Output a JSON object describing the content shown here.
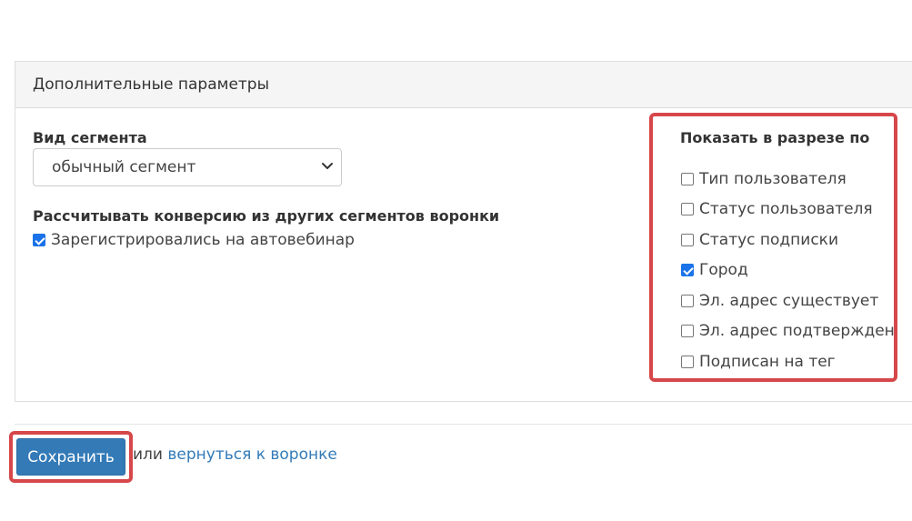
{
  "panel": {
    "heading": "Дополнительные параметры"
  },
  "segment_type": {
    "label": "Вид сегмента",
    "selected": "обычный сегмент"
  },
  "conversion": {
    "label": "Рассчитывать конверсию из других сегментов воронки",
    "options": [
      {
        "label": "Зарегистрировались на автовебинар",
        "checked": true
      }
    ]
  },
  "breakdown": {
    "title": "Показать в разрезе по",
    "options": [
      {
        "label": "Тип пользователя",
        "checked": false
      },
      {
        "label": "Статус пользователя",
        "checked": false
      },
      {
        "label": "Статус подписки",
        "checked": false
      },
      {
        "label": "Город",
        "checked": true
      },
      {
        "label": "Эл. адрес существует",
        "checked": false
      },
      {
        "label": "Эл. адрес подтвержден",
        "checked": false
      },
      {
        "label": "Подписан на тег",
        "checked": false
      }
    ]
  },
  "footer": {
    "save_label": "Сохранить",
    "or_text": "или",
    "back_link": "вернуться к воронке"
  },
  "colors": {
    "primary": "#337ab7",
    "highlight": "#d6474a",
    "checkbox_checked": "#1a73e8"
  }
}
